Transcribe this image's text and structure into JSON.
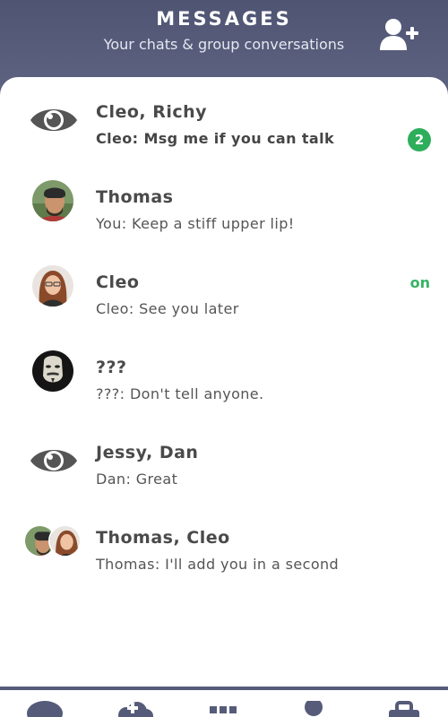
{
  "header": {
    "title": "MESSAGES",
    "subtitle": "Your chats & group conversations",
    "add_icon": "add-user-icon"
  },
  "conversations": [
    {
      "name": "Cleo, Richy",
      "preview": "Cleo: Msg me if you can talk",
      "avatar": "eye-icon",
      "unread_count": "2",
      "unread": true
    },
    {
      "name": "Thomas",
      "preview": "You: Keep a stiff upper lip!",
      "avatar": "thomas-avatar"
    },
    {
      "name": "Cleo",
      "preview": "Cleo: See you later",
      "avatar": "cleo-avatar",
      "status": "on"
    },
    {
      "name": "???",
      "preview": "???: Don't tell anyone.",
      "avatar": "masked-avatar"
    },
    {
      "name": "Jessy, Dan",
      "preview": "Dan: Great",
      "avatar": "eye-icon"
    },
    {
      "name": "Thomas, Cleo",
      "preview": "Thomas: I'll add you in a second",
      "avatar": "group-avatar"
    }
  ],
  "bottom_nav": [
    {
      "icon": "chat-bubble-icon"
    },
    {
      "icon": "cloud-icon"
    },
    {
      "icon": "grid-icon"
    },
    {
      "icon": "profile-icon"
    },
    {
      "icon": "briefcase-icon"
    }
  ],
  "colors": {
    "header_bg": "#555b79",
    "badge": "#2eae5a",
    "online": "#36b364",
    "text": "#4a4a4a"
  }
}
